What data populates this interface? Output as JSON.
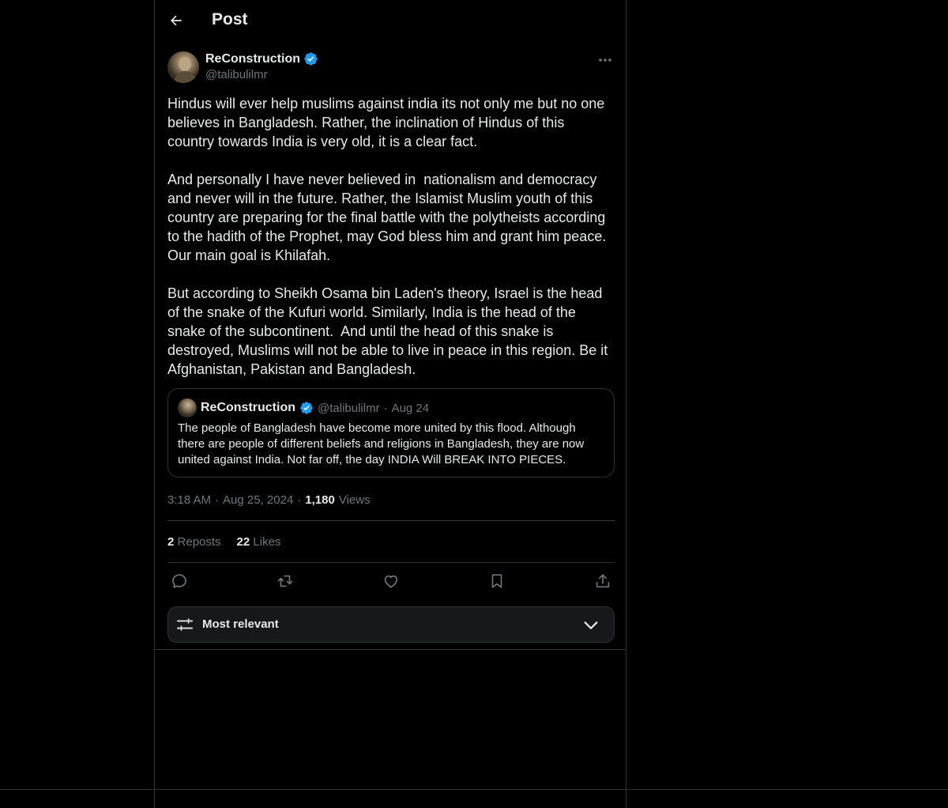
{
  "header": {
    "title": "Post"
  },
  "post": {
    "author_name": "ReConstruction",
    "author_handle": "@talibulilmr",
    "body": "Hindus will ever help muslims against india its not only me but no one believes in Bangladesh. Rather, the inclination of Hindus of this country towards India is very old, it is a clear fact.\n\nAnd personally I have never believed in  nationalism and democracy and never will in the future. Rather, the Islamist Muslim youth of this country are preparing for the final battle with the polytheists according to the hadith of the Prophet, may God bless him and grant him peace. Our main goal is Khilafah.\n\nBut according to Sheikh Osama bin Laden's theory, Israel is the head of the snake of the Kufuri world. Similarly, India is the head of the snake of the subcontinent.  And until the head of this snake is destroyed, Muslims will not be able to live in peace in this region. Be it Afghanistan, Pakistan and Bangladesh.",
    "time": "3:18 AM",
    "date": "Aug 25, 2024",
    "views_count": "1,180",
    "views_label": "Views",
    "reposts_count": "2",
    "reposts_label": "Reposts",
    "likes_count": "22",
    "likes_label": "Likes"
  },
  "quote": {
    "author_name": "ReConstruction",
    "author_handle": "@talibulilmr",
    "date": "Aug 24",
    "text": "The people of Bangladesh have become more united by this flood.  Although there are people of different beliefs and religions in Bangladesh, they are now united against India. Not far off, the day INDIA Will BREAK INTO PIECES."
  },
  "sort": {
    "label": "Most relevant"
  },
  "separator": "·",
  "icons": {
    "back": "arrow-left-icon",
    "verified": "verified-badge-icon",
    "more": "more-icon",
    "reply": "reply-icon",
    "repost": "repost-icon",
    "like": "heart-icon",
    "bookmark": "bookmark-icon",
    "share": "share-icon",
    "sort": "sliders-icon",
    "chevron": "chevron-down-icon"
  },
  "colors": {
    "background": "#000000",
    "text": "#e7e9ea",
    "muted": "#71767b",
    "border": "#2f3336",
    "verified": "#1d9bf0"
  }
}
